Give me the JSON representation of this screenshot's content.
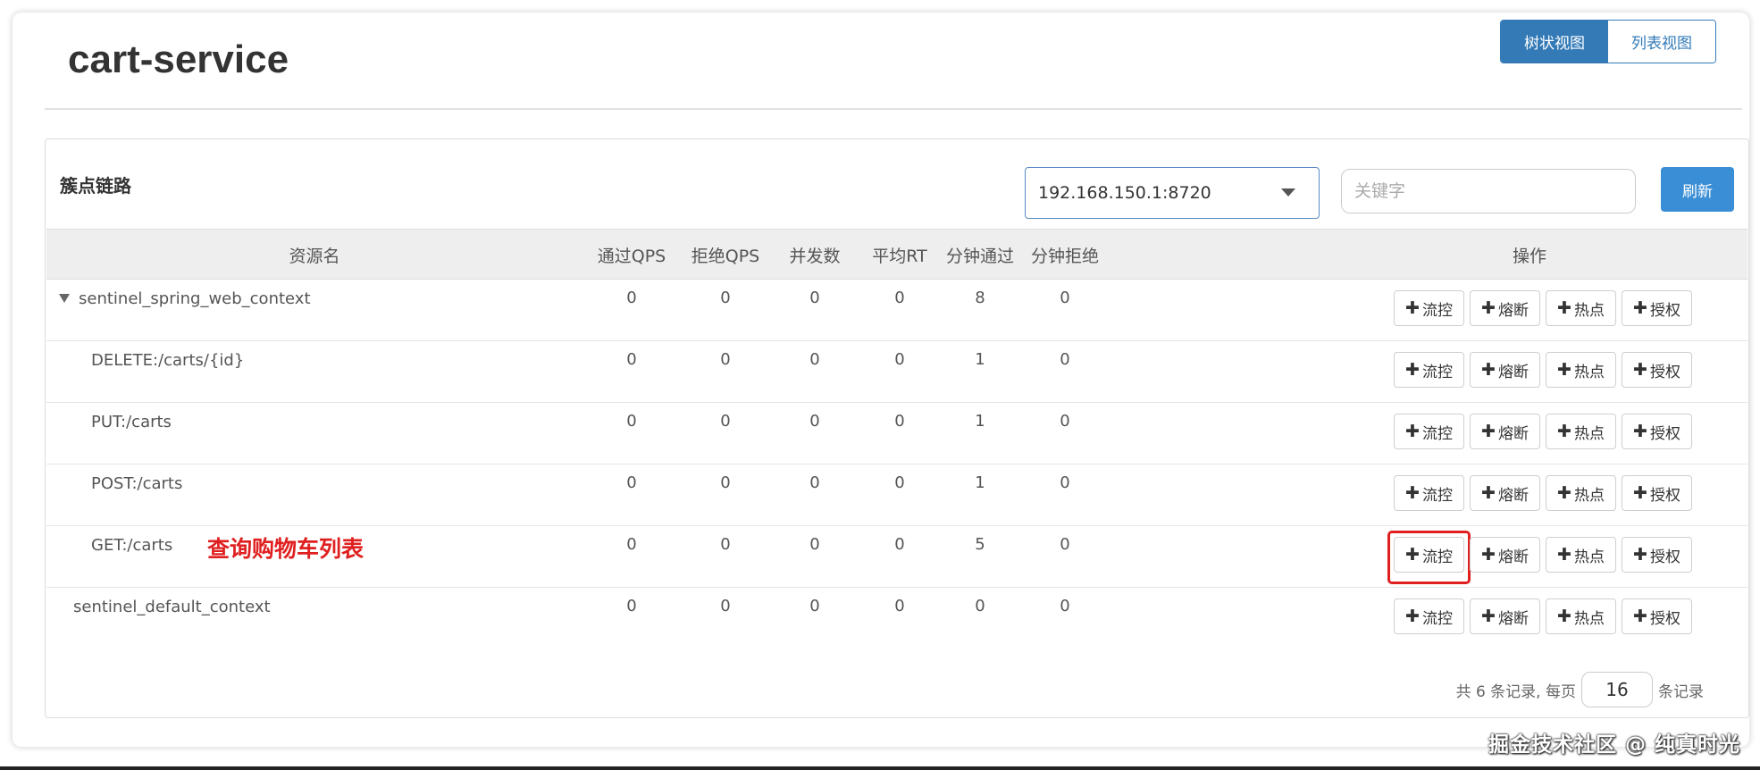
{
  "page": {
    "title": "cart-service",
    "watermark": "掘金技术社区 @ 纯真时光"
  },
  "view_toggle": {
    "tree_label": "树状视图",
    "list_label": "列表视图",
    "active": "tree"
  },
  "panel": {
    "title": "簇点链路",
    "machine_select": {
      "value": "192.168.150.1:8720"
    },
    "search": {
      "placeholder": "关键字",
      "value": ""
    },
    "refresh_label": "刷新"
  },
  "table": {
    "headers": {
      "resource": "资源名",
      "pass_qps": "通过QPS",
      "block_qps": "拒绝QPS",
      "concurrency": "并发数",
      "avg_rt": "平均RT",
      "minute_pass": "分钟通过",
      "minute_block": "分钟拒绝",
      "actions": "操作"
    },
    "action_labels": {
      "flow": "流控",
      "degrade": "熔断",
      "hotspot": "热点",
      "authority": "授权"
    },
    "rows": [
      {
        "name": "sentinel_spring_web_context",
        "pass_qps": "0",
        "block_qps": "0",
        "concurrency": "0",
        "avg_rt": "0",
        "minute_pass": "8",
        "minute_block": "0"
      },
      {
        "name": "DELETE:/carts/{id}",
        "pass_qps": "0",
        "block_qps": "0",
        "concurrency": "0",
        "avg_rt": "0",
        "minute_pass": "1",
        "minute_block": "0"
      },
      {
        "name": "PUT:/carts",
        "pass_qps": "0",
        "block_qps": "0",
        "concurrency": "0",
        "avg_rt": "0",
        "minute_pass": "1",
        "minute_block": "0"
      },
      {
        "name": "POST:/carts",
        "pass_qps": "0",
        "block_qps": "0",
        "concurrency": "0",
        "avg_rt": "0",
        "minute_pass": "1",
        "minute_block": "0"
      },
      {
        "name": "GET:/carts",
        "annotation": "查询购物车列表",
        "pass_qps": "0",
        "block_qps": "0",
        "concurrency": "0",
        "avg_rt": "0",
        "minute_pass": "5",
        "minute_block": "0"
      },
      {
        "name": "sentinel_default_context",
        "pass_qps": "0",
        "block_qps": "0",
        "concurrency": "0",
        "avg_rt": "0",
        "minute_pass": "0",
        "minute_block": "0"
      }
    ]
  },
  "pagination": {
    "prefix": "共 6 条记录, 每页",
    "page_size": "16",
    "suffix": "条记录"
  },
  "colors": {
    "primary": "#337ab7",
    "refresh": "#3a8ed6",
    "highlight": "#e02020",
    "header_bg": "#eeeeee"
  }
}
